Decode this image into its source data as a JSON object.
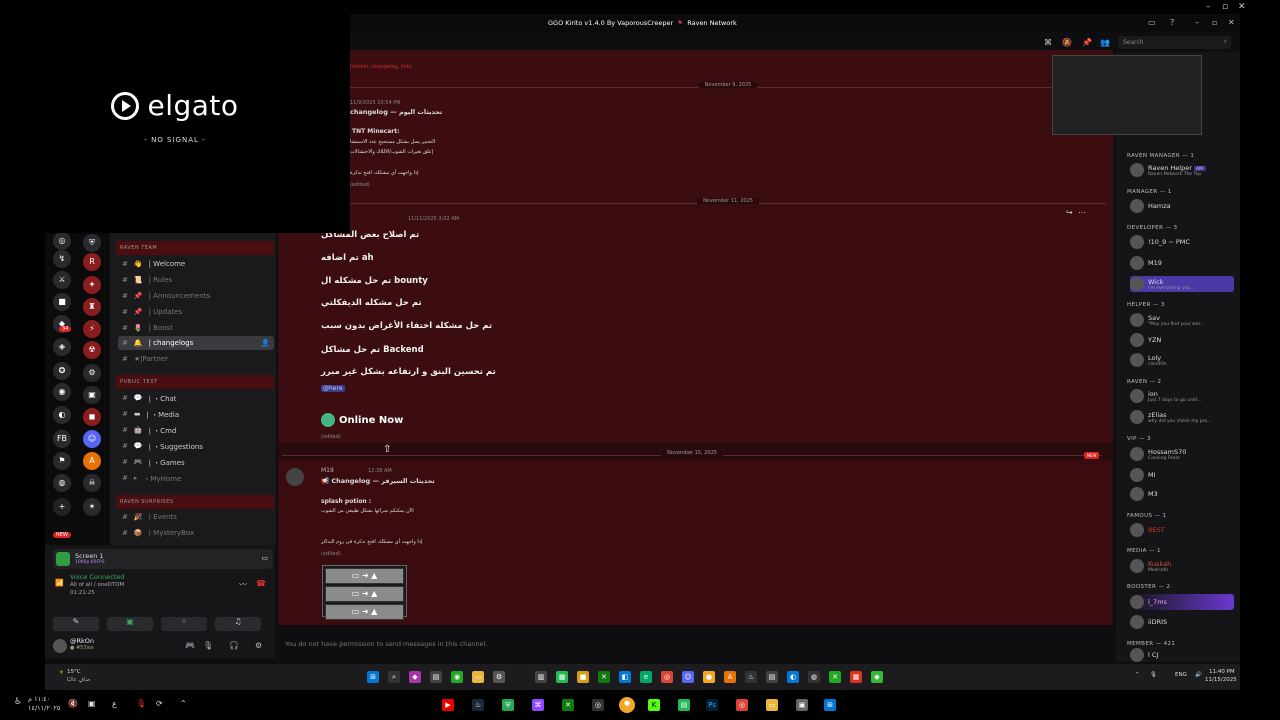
{
  "overlay": {
    "brand": "elgato",
    "signal": "- NO SIGNAL -"
  },
  "titlebar": {
    "app": "GGO Kirito v1.4.0 By VaporousCreeper",
    "network": "Raven Network"
  },
  "search": {
    "placeholder": "Search"
  },
  "channels": {
    "cat_team": "RAVEN TEAM",
    "team": [
      {
        "label": "| Welcome",
        "icon": "👋"
      },
      {
        "label": "| Rules",
        "icon": "📜"
      },
      {
        "label": "| Announcements",
        "icon": "📌"
      },
      {
        "label": "| Updates",
        "icon": "📌"
      },
      {
        "label": "| Boost",
        "icon": "🌷"
      },
      {
        "label": "| changelogs",
        "icon": "🔔"
      },
      {
        "label": "★|Partner",
        "icon": "★"
      }
    ],
    "cat_public": "PUBLIC TEXT",
    "public": [
      {
        "label": "| ・Chat",
        "icon": "💬"
      },
      {
        "label": "| ・Media",
        "icon": "▬"
      },
      {
        "label": "| ・Cmd",
        "icon": "🤖"
      },
      {
        "label": "| ・Suggestions",
        "icon": "💬"
      },
      {
        "label": "| ・Games",
        "icon": "🎮"
      },
      {
        "label": "・MyHome",
        "icon": "▸"
      }
    ],
    "cat_surprises": "RAVEN SURPRISES",
    "surprises": [
      {
        "label": "| Events",
        "icon": "🎉"
      },
      {
        "label": "| MysteryBox",
        "icon": "📦"
      }
    ]
  },
  "voice": {
    "screen": "Screen 1",
    "screen_sub": "1080p 60FPS",
    "status": "Voice Connected",
    "channel": "All of all / oneDTOM",
    "timer": "01:21:25",
    "user": "@RkOn",
    "user_status": "● #53ios"
  },
  "chat": {
    "date1": "November 9, 2025",
    "date2": "November 11, 2025",
    "date3": "November 15, 2025",
    "top_link": "(sticker, changelog, link)",
    "msg1_time": "11/9/2025 10:54 PM",
    "msg1_title": "changelog — تحديثات اليوم",
    "msg1_sub": "TNT Minecart:",
    "msg1_l1": "التحبير يسل بشكل مستحيج عدد الاسمشا",
    "msg1_l2": "إعلق تغيرات الشوب/الاللاك والاحتشالات",
    "msg1_l3": "إذا واجهت أي مشكلة، افتح تذكرة",
    "msg2_time": "11/11/2025 3:02 AM",
    "msg2_lines": [
      "تم اصلاح بعض المشاكل",
      "تم اضافه ah",
      "تم حل مشكله ال bounty",
      "تم حل مشكله الديفكلتي",
      "تم حل مشكله اختفاء الأغراض بدون سبب",
      "تم حل مشاكل Backend",
      "تم تحسين البنق و ارتفاعه بشكل غير مبرر"
    ],
    "mention": "@here",
    "online": "Online Now",
    "edited": "(edited)",
    "msg3_user": "M19",
    "msg3_time": "12:38 AM",
    "msg3_title": "Changelog — تحديثات السيرفر",
    "msg3_sub": "splash potion :",
    "msg3_l1": "الآن يمكنكم شرائها بشكل طبيعي من الشوب",
    "msg3_l2": "إذا واجهت أي مشكلة، افتح تذكرة في روم التذاكر",
    "new_tag": "NEW",
    "composer": "You do not have permission to send messages in this channel."
  },
  "members": [
    {
      "role": "RAVEN MANAGER — 1",
      "people": [
        {
          "name": "Raven Helper",
          "tag": "APP",
          "sub": "Raven Network The Top"
        }
      ]
    },
    {
      "role": "MANAGER — 1",
      "people": [
        {
          "name": "Hamza",
          "sub": ""
        }
      ]
    },
    {
      "role": "DEVELOPER — 3",
      "people": [
        {
          "name": "!10_9 ~ PMC",
          "sub": ""
        },
        {
          "name": "M19",
          "sub": ""
        },
        {
          "name": "Wick",
          "sub": "I'm everything you..."
        }
      ]
    },
    {
      "role": "HELPER — 3",
      "people": [
        {
          "name": "Sav",
          "sub": "\"May you find your wor..."
        },
        {
          "name": "YZN",
          "sub": ""
        },
        {
          "name": "Loly",
          "sub": "clientOn"
        }
      ]
    },
    {
      "role": "RAVEN — 2",
      "people": [
        {
          "name": "ion",
          "sub": "Just 7 days to go until..."
        },
        {
          "name": "zElias",
          "sub": "why did you check my pro..."
        }
      ]
    },
    {
      "role": "VIP — 3",
      "people": [
        {
          "name": "HossamS70",
          "sub": "Cooking Fever"
        },
        {
          "name": "MI",
          "sub": ""
        },
        {
          "name": "M3",
          "sub": ""
        }
      ]
    },
    {
      "role": "FAMOUS — 1",
      "people": [
        {
          "name": "BEST",
          "sub": ""
        }
      ]
    },
    {
      "role": "MEDIA — 1",
      "people": [
        {
          "name": "Kuskah",
          "sub": "Medrinth"
        }
      ]
    },
    {
      "role": "BOOSTER — 2",
      "people": [
        {
          "name": "l_7ms",
          "sub": ""
        },
        {
          "name": "iiDRIS",
          "sub": ""
        }
      ]
    },
    {
      "role": "MEMBER — 421",
      "people": [
        {
          "name": "l CJ",
          "sub": ""
        }
      ]
    }
  ],
  "taskbar": {
    "weather_temp": "15°C",
    "weather_desc": "صافٍ غالبًا",
    "time": "11:40 PM",
    "date": "11/15/2025",
    "lang": "ENG"
  },
  "bottom": {
    "clock": "١١:٤٠ م",
    "date": "١٤/١١/٢٠٢٥",
    "lang": "ع"
  }
}
